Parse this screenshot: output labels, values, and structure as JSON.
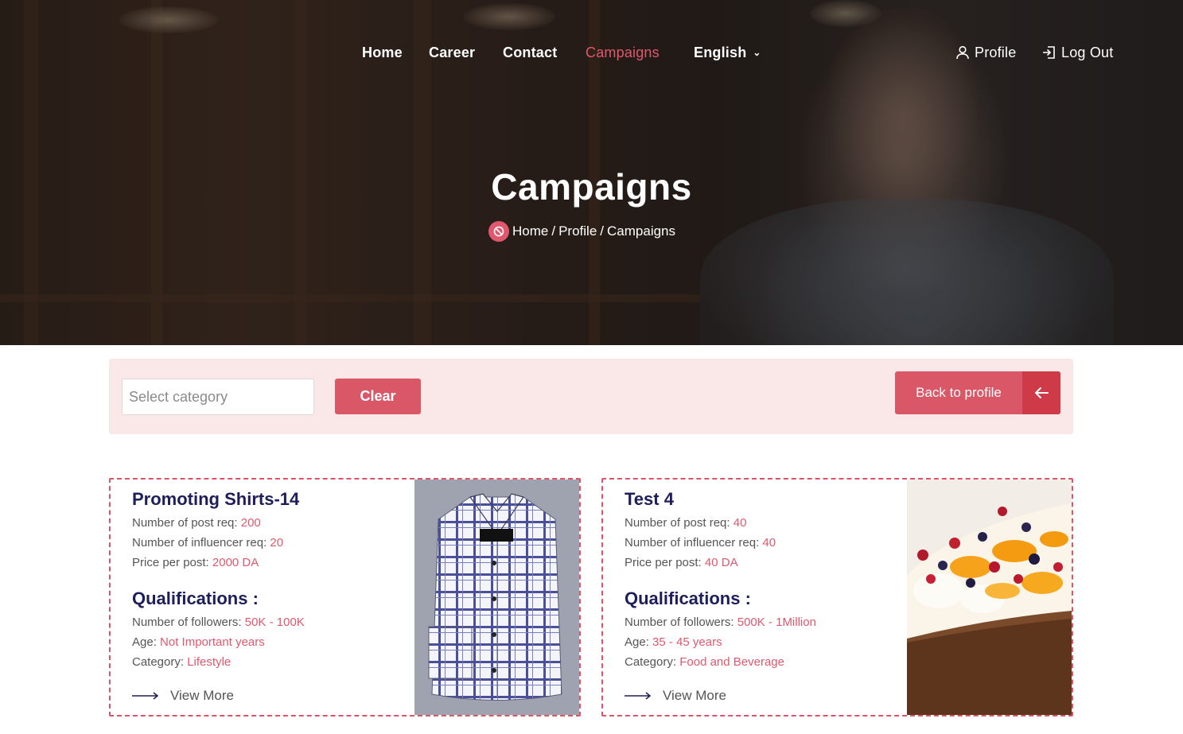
{
  "nav": {
    "items": [
      {
        "label": "Home"
      },
      {
        "label": "Career"
      },
      {
        "label": "Contact"
      },
      {
        "label": "Campaigns"
      }
    ],
    "language": "English",
    "profile": "Profile",
    "logout": "Log Out"
  },
  "hero": {
    "title": "Campaigns",
    "breadcrumb": [
      "Home",
      "Profile",
      "Campaigns"
    ],
    "separator": "/"
  },
  "filter": {
    "category_placeholder": "Select category",
    "clear_label": "Clear",
    "back_label": "Back to profile"
  },
  "colors": {
    "accent": "#e0586d",
    "heading": "#1e1f5a",
    "filter_bg": "#fae8e9"
  },
  "campaigns": [
    {
      "title": "Promoting Shirts-14",
      "posts_label": "Number of post req:",
      "posts": "200",
      "influencers_label": "Number of influencer req:",
      "influencers": "20",
      "price_label": "Price per post:",
      "price": "2000 DA",
      "qualifications_label": "Qualifications :",
      "followers_label": "Number of followers:",
      "followers": "50K - 100K",
      "age_label": "Age:",
      "age": "Not Important years",
      "category_label": "Category:",
      "category": "Lifestyle",
      "view_more": "View More"
    },
    {
      "title": "Test 4",
      "posts_label": "Number of post req:",
      "posts": "40",
      "influencers_label": "Number of influencer req:",
      "influencers": "40",
      "price_label": "Price per post:",
      "price": "40 DA",
      "qualifications_label": "Qualifications :",
      "followers_label": "Number of followers:",
      "followers": "500K - 1Million",
      "age_label": "Age:",
      "age": "35 - 45 years",
      "category_label": "Category:",
      "category": "Food and Beverage",
      "view_more": "View More"
    }
  ]
}
